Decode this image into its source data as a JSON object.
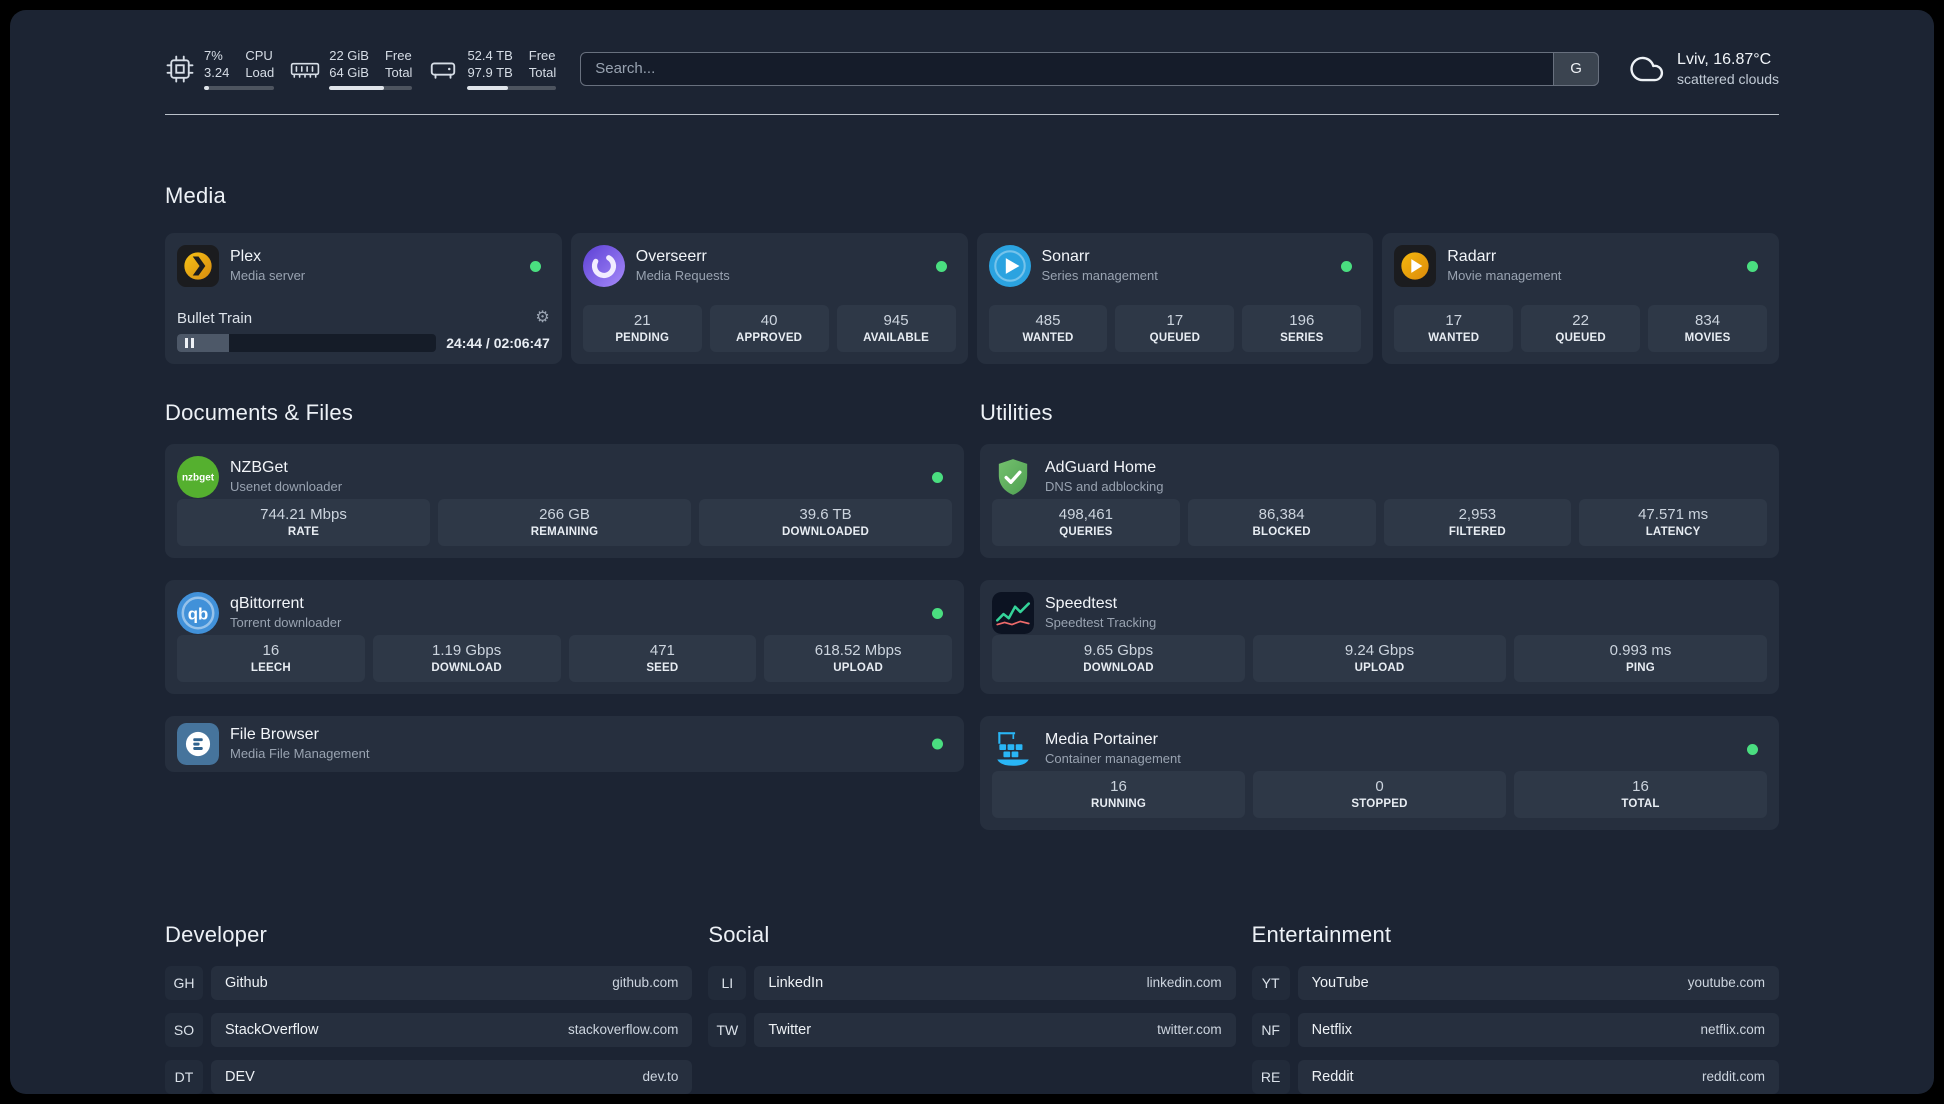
{
  "colors": {
    "status_online": "#4ade80",
    "page_bg": "#1c2433",
    "card_bg": "#262f3e"
  },
  "topbar": {
    "cpu": {
      "line1_left": "7%",
      "line2_left": "3.24",
      "line1_right": "CPU",
      "line2_right": "Load",
      "percent": 7
    },
    "memory": {
      "line1_left": "22 GiB",
      "line2_left": "64 GiB",
      "line1_right": "Free",
      "line2_right": "Total",
      "percent": 66
    },
    "disk": {
      "line1_left": "52.4 TB",
      "line2_left": "97.9 TB",
      "line1_right": "Free",
      "line2_right": "Total",
      "percent": 46
    },
    "search": {
      "placeholder": "Search...",
      "provider": "G"
    },
    "weather": {
      "location": "Lviv, 16.87°C",
      "condition": "scattered clouds"
    }
  },
  "media": {
    "title": "Media",
    "plex": {
      "name": "Plex",
      "desc": "Media server",
      "online": true,
      "now_playing": "Bullet Train",
      "time": "24:44 / 02:06:47",
      "progress_percent": 20
    },
    "overseerr": {
      "name": "Overseerr",
      "desc": "Media Requests",
      "online": true,
      "stats": [
        {
          "value": "21",
          "label": "PENDING"
        },
        {
          "value": "40",
          "label": "APPROVED"
        },
        {
          "value": "945",
          "label": "AVAILABLE"
        }
      ]
    },
    "sonarr": {
      "name": "Sonarr",
      "desc": "Series management",
      "online": true,
      "stats": [
        {
          "value": "485",
          "label": "WANTED"
        },
        {
          "value": "17",
          "label": "QUEUED"
        },
        {
          "value": "196",
          "label": "SERIES"
        }
      ]
    },
    "radarr": {
      "name": "Radarr",
      "desc": "Movie management",
      "online": true,
      "stats": [
        {
          "value": "17",
          "label": "WANTED"
        },
        {
          "value": "22",
          "label": "QUEUED"
        },
        {
          "value": "834",
          "label": "MOVIES"
        }
      ]
    }
  },
  "documents": {
    "title": "Documents & Files",
    "nzbget": {
      "name": "NZBGet",
      "desc": "Usenet downloader",
      "online": true,
      "stats": [
        {
          "value": "744.21 Mbps",
          "label": "RATE"
        },
        {
          "value": "266 GB",
          "label": "REMAINING"
        },
        {
          "value": "39.6 TB",
          "label": "DOWNLOADED"
        }
      ]
    },
    "qbittorrent": {
      "name": "qBittorrent",
      "desc": "Torrent downloader",
      "online": true,
      "stats": [
        {
          "value": "16",
          "label": "LEECH"
        },
        {
          "value": "1.19 Gbps",
          "label": "DOWNLOAD"
        },
        {
          "value": "471",
          "label": "SEED"
        },
        {
          "value": "618.52 Mbps",
          "label": "UPLOAD"
        }
      ]
    },
    "filebrowser": {
      "name": "File Browser",
      "desc": "Media File Management",
      "online": true
    }
  },
  "utilities": {
    "title": "Utilities",
    "adguard": {
      "name": "AdGuard Home",
      "desc": "DNS and adblocking",
      "stats": [
        {
          "value": "498,461",
          "label": "QUERIES"
        },
        {
          "value": "86,384",
          "label": "BLOCKED"
        },
        {
          "value": "2,953",
          "label": "FILTERED"
        },
        {
          "value": "47.571 ms",
          "label": "LATENCY"
        }
      ]
    },
    "speedtest": {
      "name": "Speedtest",
      "desc": "Speedtest Tracking",
      "stats": [
        {
          "value": "9.65 Gbps",
          "label": "DOWNLOAD"
        },
        {
          "value": "9.24 Gbps",
          "label": "UPLOAD"
        },
        {
          "value": "0.993 ms",
          "label": "PING"
        }
      ]
    },
    "portainer": {
      "name": "Media Portainer",
      "desc": "Container management",
      "online": true,
      "stats": [
        {
          "value": "16",
          "label": "RUNNING"
        },
        {
          "value": "0",
          "label": "STOPPED"
        },
        {
          "value": "16",
          "label": "TOTAL"
        }
      ]
    }
  },
  "bookmarks": [
    {
      "title": "Developer",
      "items": [
        {
          "abbr": "GH",
          "name": "Github",
          "domain": "github.com"
        },
        {
          "abbr": "SO",
          "name": "StackOverflow",
          "domain": "stackoverflow.com"
        },
        {
          "abbr": "DT",
          "name": "DEV",
          "domain": "dev.to"
        }
      ]
    },
    {
      "title": "Social",
      "items": [
        {
          "abbr": "LI",
          "name": "LinkedIn",
          "domain": "linkedin.com"
        },
        {
          "abbr": "TW",
          "name": "Twitter",
          "domain": "twitter.com"
        }
      ]
    },
    {
      "title": "Entertainment",
      "items": [
        {
          "abbr": "YT",
          "name": "YouTube",
          "domain": "youtube.com"
        },
        {
          "abbr": "NF",
          "name": "Netflix",
          "domain": "netflix.com"
        },
        {
          "abbr": "RE",
          "name": "Reddit",
          "domain": "reddit.com"
        }
      ]
    }
  ]
}
